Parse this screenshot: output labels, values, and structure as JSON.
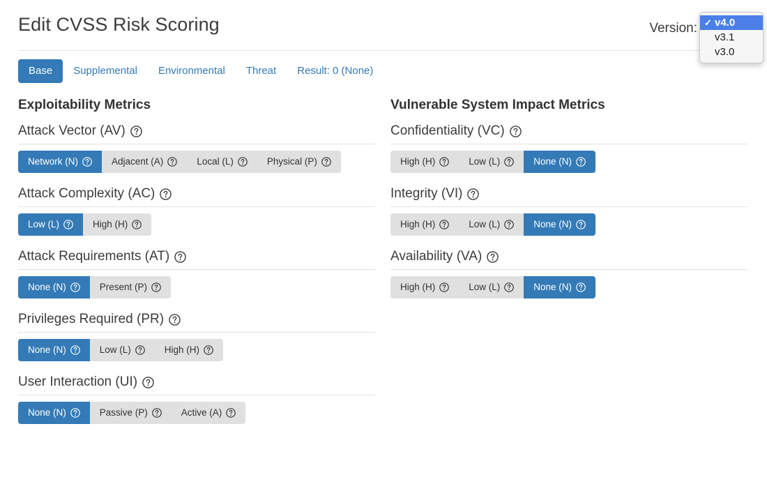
{
  "header": {
    "title": "Edit CVSS Risk Scoring",
    "version_label": "Version:",
    "version_selected": "v4.0",
    "version_options": [
      {
        "label": "v4.0",
        "selected": true
      },
      {
        "label": "v3.1",
        "selected": false
      },
      {
        "label": "v3.0",
        "selected": false
      }
    ],
    "check_glyph": "✓"
  },
  "tabs": [
    {
      "label": "Base",
      "active": true
    },
    {
      "label": "Supplemental",
      "active": false
    },
    {
      "label": "Environmental",
      "active": false
    },
    {
      "label": "Threat",
      "active": false
    },
    {
      "label": "Result: 0 (None)",
      "active": false
    }
  ],
  "colors": {
    "primary": "#337ab7",
    "group_bg": "#e0e0e0",
    "rule": "#e2e2e2",
    "popup_highlight": "#4a7fe8",
    "text": "#333333",
    "link": "#337ab7"
  },
  "columns": [
    {
      "heading": "Exploitability Metrics",
      "metrics": [
        {
          "label": "Attack Vector (AV)",
          "options": [
            {
              "label": "Network (N)",
              "selected": true
            },
            {
              "label": "Adjacent (A)",
              "selected": false
            },
            {
              "label": "Local (L)",
              "selected": false
            },
            {
              "label": "Physical (P)",
              "selected": false
            }
          ]
        },
        {
          "label": "Attack Complexity (AC)",
          "options": [
            {
              "label": "Low (L)",
              "selected": true
            },
            {
              "label": "High (H)",
              "selected": false
            }
          ]
        },
        {
          "label": "Attack Requirements (AT)",
          "options": [
            {
              "label": "None (N)",
              "selected": true
            },
            {
              "label": "Present (P)",
              "selected": false
            }
          ]
        },
        {
          "label": "Privileges Required (PR)",
          "options": [
            {
              "label": "None (N)",
              "selected": true
            },
            {
              "label": "Low (L)",
              "selected": false
            },
            {
              "label": "High (H)",
              "selected": false
            }
          ]
        },
        {
          "label": "User Interaction (UI)",
          "options": [
            {
              "label": "None (N)",
              "selected": true
            },
            {
              "label": "Passive (P)",
              "selected": false
            },
            {
              "label": "Active (A)",
              "selected": false
            }
          ]
        }
      ]
    },
    {
      "heading": "Vulnerable System Impact Metrics",
      "metrics": [
        {
          "label": "Confidentiality (VC)",
          "options": [
            {
              "label": "High (H)",
              "selected": false
            },
            {
              "label": "Low (L)",
              "selected": false
            },
            {
              "label": "None (N)",
              "selected": true
            }
          ]
        },
        {
          "label": "Integrity (VI)",
          "options": [
            {
              "label": "High (H)",
              "selected": false
            },
            {
              "label": "Low (L)",
              "selected": false
            },
            {
              "label": "None (N)",
              "selected": true
            }
          ]
        },
        {
          "label": "Availability (VA)",
          "options": [
            {
              "label": "High (H)",
              "selected": false
            },
            {
              "label": "Low (L)",
              "selected": false
            },
            {
              "label": "None (N)",
              "selected": true
            }
          ]
        }
      ]
    }
  ]
}
